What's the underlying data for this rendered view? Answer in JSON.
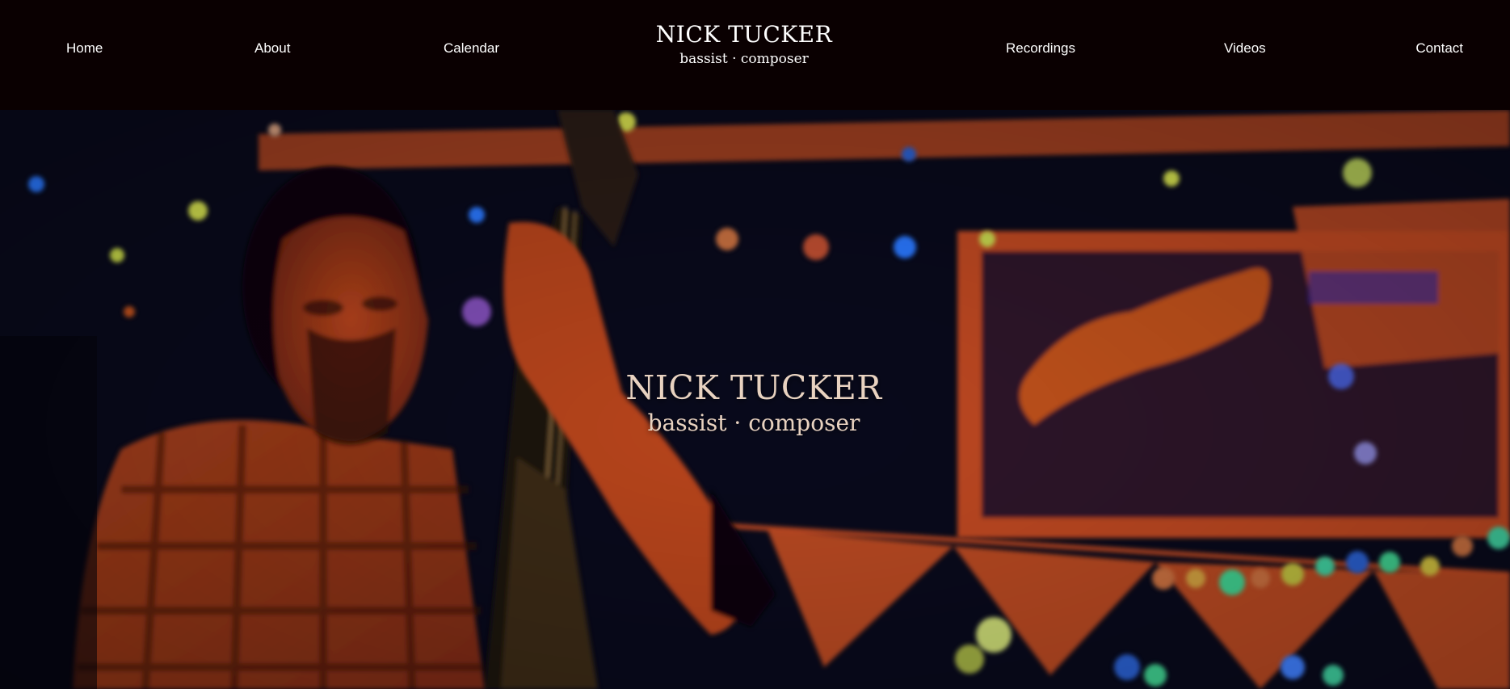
{
  "nav": {
    "home": "Home",
    "about": "About",
    "calendar": "Calendar",
    "recordings": "Recordings",
    "videos": "Videos",
    "contact": "Contact"
  },
  "brand": {
    "name": "NICK TUCKER",
    "tagline": "bassist · composer"
  },
  "hero": {
    "title": "NICK TUCKER",
    "subtitle": "bassist · composer",
    "image": "photo of a double bassist performing on a dimly lit stage with bokeh lights and bunting"
  },
  "colors": {
    "header_bg": "#0a0001",
    "nav_text": "#ffffff",
    "hero_text": "#e8d2c0",
    "hero_orange": "#c4441f",
    "hero_dark": "#07060f"
  }
}
